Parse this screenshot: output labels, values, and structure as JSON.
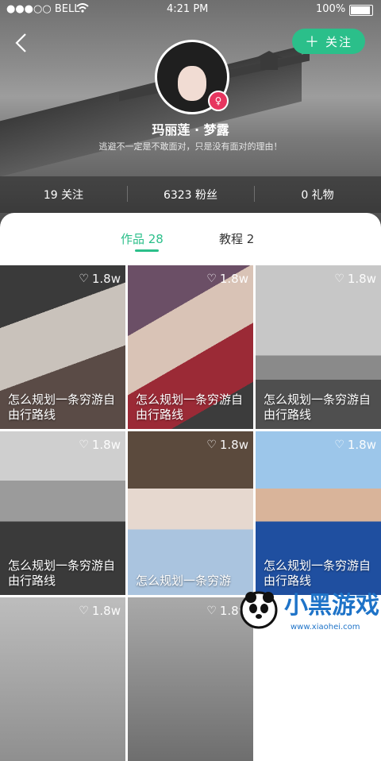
{
  "status": {
    "carrier": "●●●○○ BELL",
    "wifi_icon": "wifi-icon",
    "time": "4:21 PM",
    "battery": "100%"
  },
  "header": {
    "follow_label": "关注",
    "plus": "＋"
  },
  "profile": {
    "name": "玛丽莲 · 梦露",
    "bio": "逃避不一定是不敢面对，只是没有面对的理由！",
    "gender_symbol": "♀"
  },
  "stats": [
    {
      "label": "19 关注"
    },
    {
      "label": "6323 粉丝"
    },
    {
      "label": "0 礼物"
    }
  ],
  "tabs": [
    {
      "label": "作品 28"
    },
    {
      "label": "教程 2"
    }
  ],
  "cards": [
    {
      "likes": "1.8w",
      "title": "怎么规划一条穷游自由行路线"
    },
    {
      "likes": "1.8w",
      "title": "怎么规划一条穷游自由行路线"
    },
    {
      "likes": "1.8w",
      "title": "怎么规划一条穷游自由行路线"
    },
    {
      "likes": "1.8w",
      "title": "怎么规划一条穷游自由行路线"
    },
    {
      "likes": "1.8w",
      "title": "怎么规划一条穷游"
    },
    {
      "likes": "1.8w",
      "title": "怎么规划一条穷游自由行路线"
    },
    {
      "likes": "1.8w",
      "title": ""
    },
    {
      "likes": "1.8w",
      "title": ""
    }
  ],
  "watermark": {
    "text": "小黑游戏",
    "url": "www.xiaohei.com"
  },
  "colors": {
    "accent": "#2bbf8a",
    "gender": "#e7355f"
  }
}
